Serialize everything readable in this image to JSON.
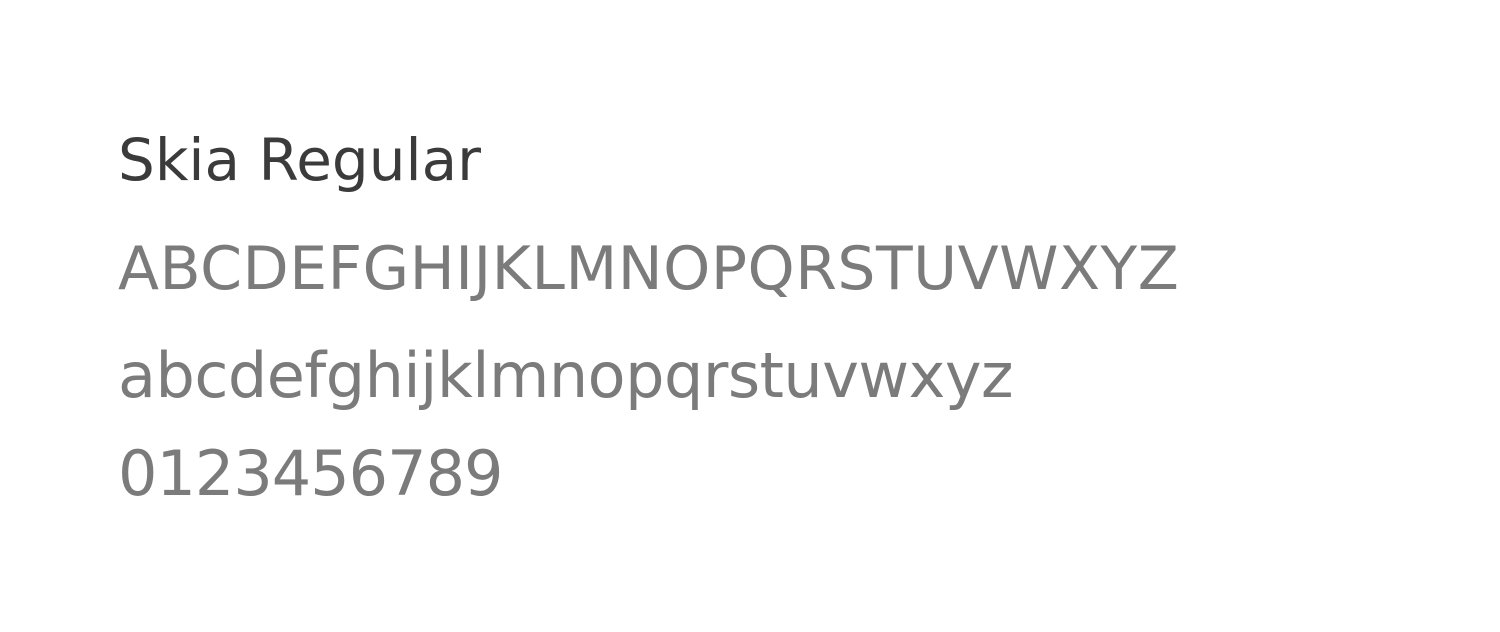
{
  "specimen": {
    "font_name": "Skia Regular",
    "uppercase": "ABCDEFGHIJKLMNOPQRSTUVWXYZ",
    "lowercase": "abcdefghijklmnopqrstuvwxyz",
    "digits": "0123456789"
  },
  "colors": {
    "background": "#ffffff",
    "title_text": "#3b3b3c",
    "sample_text": "#7b7b7c"
  }
}
